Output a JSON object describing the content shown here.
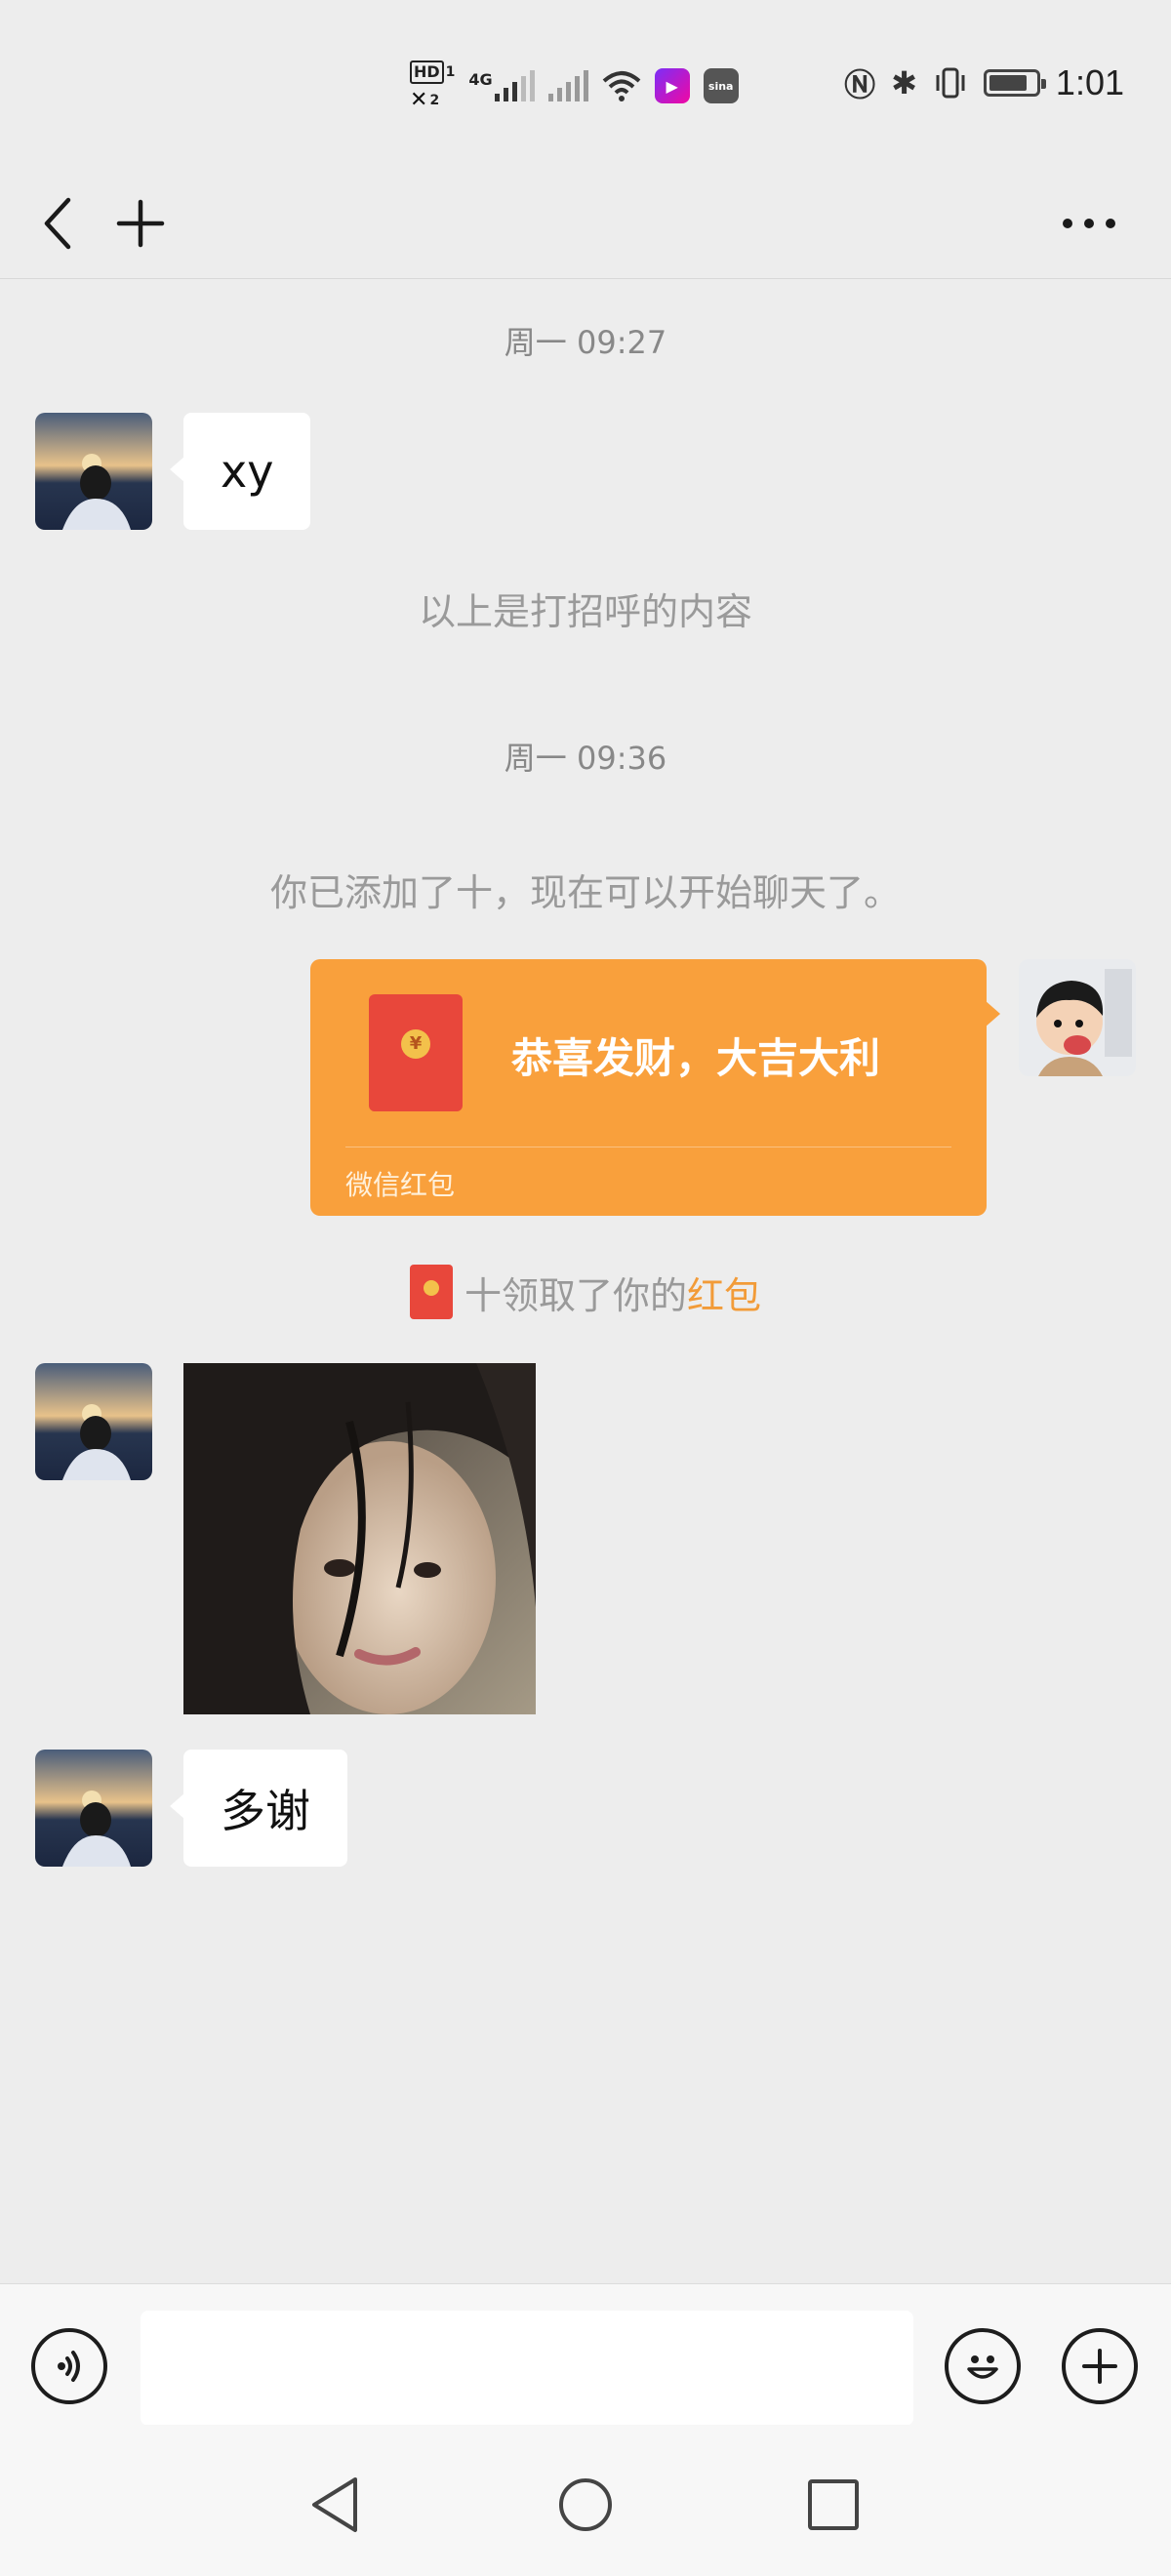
{
  "status_bar": {
    "time": "1:01",
    "hd_badge": "HD",
    "sim1": "1",
    "sim2": "2",
    "network": "4G",
    "sina_label": "sina",
    "battery_level": 0.85
  },
  "header": {
    "back_icon": "chevron-left-icon",
    "add_icon": "plus-icon",
    "more_icon": "more-horizontal-icon"
  },
  "chat": {
    "timestamp_1": "周一 09:27",
    "message_1": "xy",
    "system_1": "以上是打招呼的内容",
    "timestamp_2": "周一 09:36",
    "system_2": "你已添加了十，现在可以开始聊天了。",
    "red_packet": {
      "title": "恭喜发财，大吉大利",
      "footer": "微信红包",
      "coin_symbol": "¥",
      "color": "#f9a03c"
    },
    "receipt": {
      "prefix": "十领取了你的",
      "highlight": "红包",
      "highlight_color": "#f29b38"
    },
    "message_3": "多谢"
  },
  "input_bar": {
    "voice_icon": "voice-icon",
    "emoji_icon": "emoji-icon",
    "plus_icon": "plus-circle-icon",
    "text_value": ""
  },
  "nav_bar": {
    "back_icon": "nav-back-icon",
    "home_icon": "nav-home-icon",
    "recents_icon": "nav-recents-icon"
  }
}
